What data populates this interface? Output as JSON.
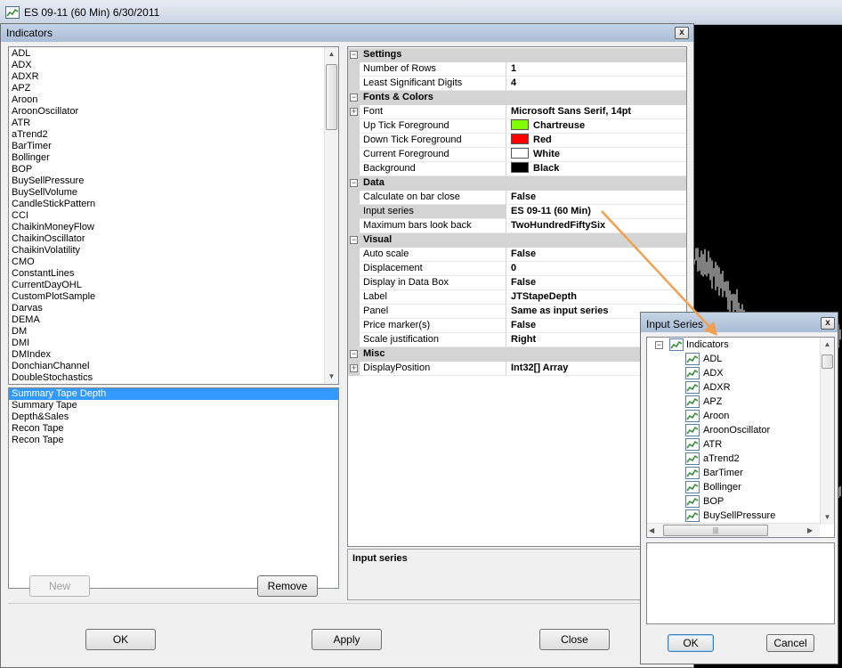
{
  "chart_window": {
    "title": "ES 09-11 (60 Min)  6/30/2011"
  },
  "indicators_dialog": {
    "title": "Indicators",
    "close_glyph": "x",
    "available_indicators": [
      "ADL",
      "ADX",
      "ADXR",
      "APZ",
      "Aroon",
      "AroonOscillator",
      "ATR",
      "aTrend2",
      "BarTimer",
      "Bollinger",
      "BOP",
      "BuySellPressure",
      "BuySellVolume",
      "CandleStickPattern",
      "CCI",
      "ChaikinMoneyFlow",
      "ChaikinOscillator",
      "ChaikinVolatility",
      "CMO",
      "ConstantLines",
      "CurrentDayOHL",
      "CustomPlotSample",
      "Darvas",
      "DEMA",
      "DM",
      "DMI",
      "DMIndex",
      "DonchianChannel",
      "DoubleStochastics"
    ],
    "applied_indicators": [
      "Summary Tape Depth",
      "Summary Tape",
      "Depth&Sales",
      "Recon Tape",
      "Recon Tape"
    ],
    "applied_selected_index": 0,
    "buttons": {
      "new": "New",
      "remove": "Remove",
      "ok": "OK",
      "apply": "Apply",
      "close": "Close"
    },
    "property_grid": {
      "categories": [
        {
          "label": "Settings",
          "props": [
            {
              "name": "Number of Rows",
              "value": "1"
            },
            {
              "name": "Least Significant Digits",
              "value": "4"
            }
          ]
        },
        {
          "label": "Fonts & Colors",
          "props": [
            {
              "name": "Font",
              "value": "Microsoft Sans Serif, 14pt",
              "expandable": true
            },
            {
              "name": "Up Tick Foreground",
              "value": "Chartreuse",
              "swatch": "#7fff00"
            },
            {
              "name": "Down Tick Foreground",
              "value": "Red",
              "swatch": "#ff0000"
            },
            {
              "name": "Current Foreground",
              "value": "White",
              "swatch": "#ffffff"
            },
            {
              "name": "Background",
              "value": "Black",
              "swatch": "#000000"
            }
          ]
        },
        {
          "label": "Data",
          "props": [
            {
              "name": "Calculate on bar close",
              "value": "False"
            },
            {
              "name": "Input series",
              "value": "ES 09-11 (60 Min)",
              "selected": true
            },
            {
              "name": "Maximum bars look back",
              "value": "TwoHundredFiftySix"
            }
          ]
        },
        {
          "label": "Visual",
          "props": [
            {
              "name": "Auto scale",
              "value": "False"
            },
            {
              "name": "Displacement",
              "value": "0"
            },
            {
              "name": "Display in Data Box",
              "value": "False"
            },
            {
              "name": "Label",
              "value": "JTStapeDepth"
            },
            {
              "name": "Panel",
              "value": "Same as input series"
            },
            {
              "name": "Price marker(s)",
              "value": "False"
            },
            {
              "name": "Scale justification",
              "value": "Right"
            }
          ]
        },
        {
          "label": "Misc",
          "props": [
            {
              "name": "DisplayPosition",
              "value": "Int32[] Array",
              "expandable": true
            }
          ]
        }
      ],
      "collapse_glyph": "−",
      "expand_glyph": "+"
    },
    "help": {
      "title": "Input series"
    }
  },
  "input_series_dialog": {
    "title": "Input Series",
    "close_glyph": "x",
    "tree_root": "Indicators",
    "tree_items": [
      "ADL",
      "ADX",
      "ADXR",
      "APZ",
      "Aroon",
      "AroonOscillator",
      "ATR",
      "aTrend2",
      "BarTimer",
      "Bollinger",
      "BOP",
      "BuySellPressure"
    ],
    "buttons": {
      "ok": "OK",
      "cancel": "Cancel"
    }
  },
  "colors": {
    "annotation_arrow": "#f0a050",
    "selection": "#3399ff",
    "category_bg": "#d4d4d4"
  }
}
